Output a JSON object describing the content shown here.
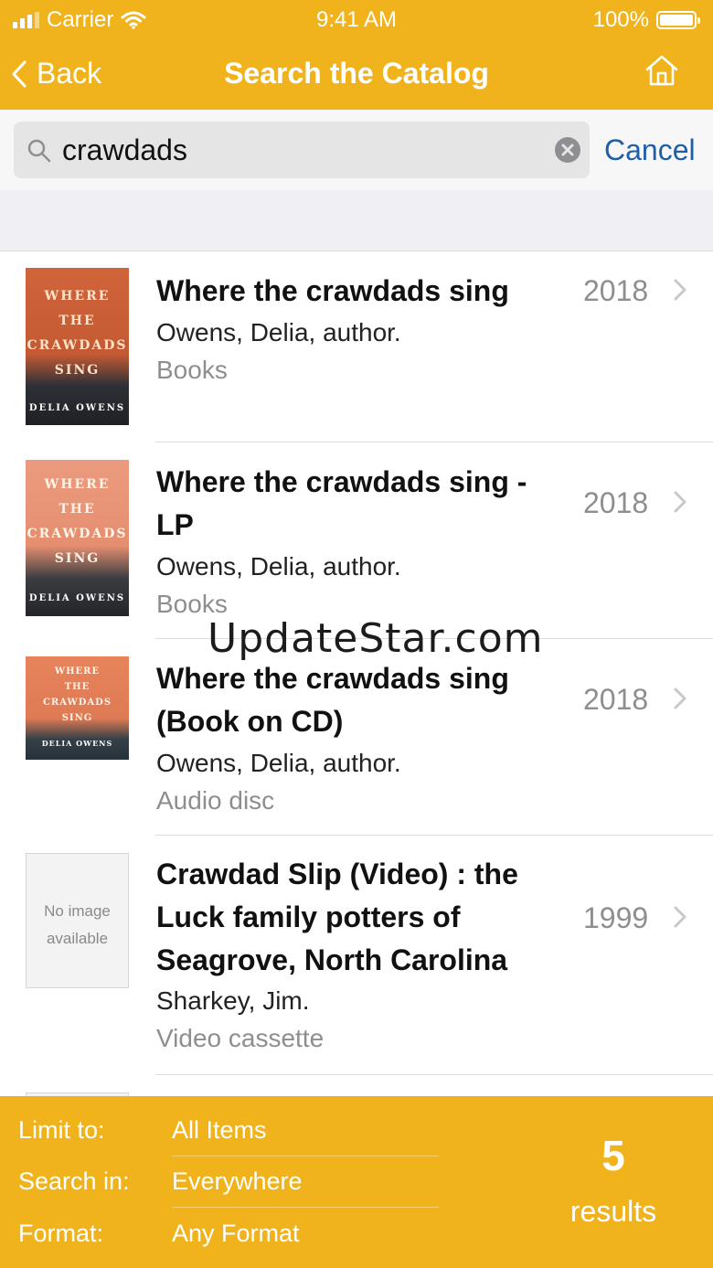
{
  "status_bar": {
    "carrier": "Carrier",
    "time": "9:41 AM",
    "battery": "100%"
  },
  "nav": {
    "back_label": "Back",
    "title": "Search the Catalog"
  },
  "search": {
    "query": "crawdads",
    "cancel_label": "Cancel"
  },
  "results": [
    {
      "title": "Where the crawdads sing",
      "author": "Owens, Delia, author.",
      "format": "Books",
      "year": "2018",
      "cover_lines": [
        "WHERE",
        "THE",
        "CRAWDADS",
        "SING"
      ],
      "cover_author": "DELIA OWENS"
    },
    {
      "title": "Where the crawdads sing - LP",
      "author": "Owens, Delia, author.",
      "format": "Books",
      "year": "2018",
      "cover_lines": [
        "WHERE",
        "THE",
        "CRAWDADS",
        "SING"
      ],
      "cover_author": "DELIA OWENS"
    },
    {
      "title": "Where the crawdads sing (Book on CD)",
      "author": "Owens, Delia, author.",
      "format": "Audio disc",
      "year": "2018",
      "cover_lines": [
        "WHERE",
        "THE",
        "CRAWDADS",
        "SING"
      ],
      "cover_author": "DELIA OWENS"
    },
    {
      "title": "Crawdad Slip (Video) : the Luck family potters of Seagrove, North Carolina",
      "author": "Sharkey, Jim.",
      "format": "Video cassette",
      "year": "1999",
      "no_image_line1": "No image",
      "no_image_line2": "available"
    }
  ],
  "footer": {
    "limit_label": "Limit to:",
    "limit_value": "All Items",
    "search_in_label": "Search in:",
    "search_in_value": "Everywhere",
    "format_label": "Format:",
    "format_value": "Any Format",
    "count": "5",
    "count_label": "results"
  },
  "watermark": "UpdateStar.com",
  "colors": {
    "accent": "#f0b31b",
    "link": "#1f5fa8"
  }
}
